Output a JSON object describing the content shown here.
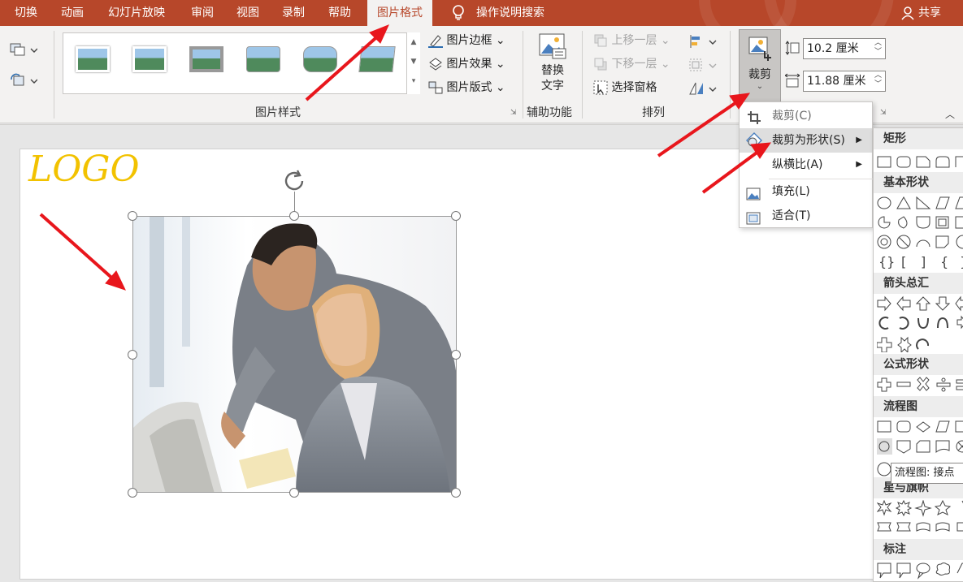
{
  "tabs": [
    {
      "label": "切换",
      "active": false
    },
    {
      "label": "动画",
      "active": false
    },
    {
      "label": "幻灯片放映",
      "active": false
    },
    {
      "label": "审阅",
      "active": false
    },
    {
      "label": "视图",
      "active": false
    },
    {
      "label": "录制",
      "active": false
    },
    {
      "label": "帮助",
      "active": false
    },
    {
      "label": "图片格式",
      "active": true
    }
  ],
  "search_label": "操作说明搜索",
  "share_label": "共享",
  "ribbon": {
    "picture_styles_label": "图片样式",
    "border_label": "图片边框",
    "effects_label": "图片效果",
    "layout_label": "图片版式",
    "alt_text_line1": "替换",
    "alt_text_line2": "文字",
    "accessibility_label": "辅助功能",
    "bring_forward_label": "上移一层",
    "send_backward_label": "下移一层",
    "selection_pane_label": "选择窗格",
    "arrange_label": "排列",
    "crop_label": "裁剪",
    "height_value": "10.2 厘米",
    "width_value": "11.88 厘米"
  },
  "slide": {
    "logo_text": "LOGO"
  },
  "crop_menu": {
    "items": [
      {
        "label": "裁剪(C)",
        "disabled": true,
        "submenu": false
      },
      {
        "label": "裁剪为形状(S)",
        "disabled": false,
        "submenu": true
      },
      {
        "label": "纵横比(A)",
        "disabled": false,
        "submenu": true
      },
      {
        "label": "填充(L)",
        "disabled": false,
        "submenu": false
      },
      {
        "label": "适合(T)",
        "disabled": false,
        "submenu": false
      }
    ]
  },
  "shapes_panel": {
    "sections": [
      "矩形",
      "基本形状",
      "箭头总汇",
      "公式形状",
      "流程图",
      "星与旗帜",
      "标注"
    ],
    "tooltip": "流程图: 接点"
  },
  "colors": {
    "accent": "#b7472a",
    "logo": "#f2c200",
    "arrow": "#e8161c"
  }
}
